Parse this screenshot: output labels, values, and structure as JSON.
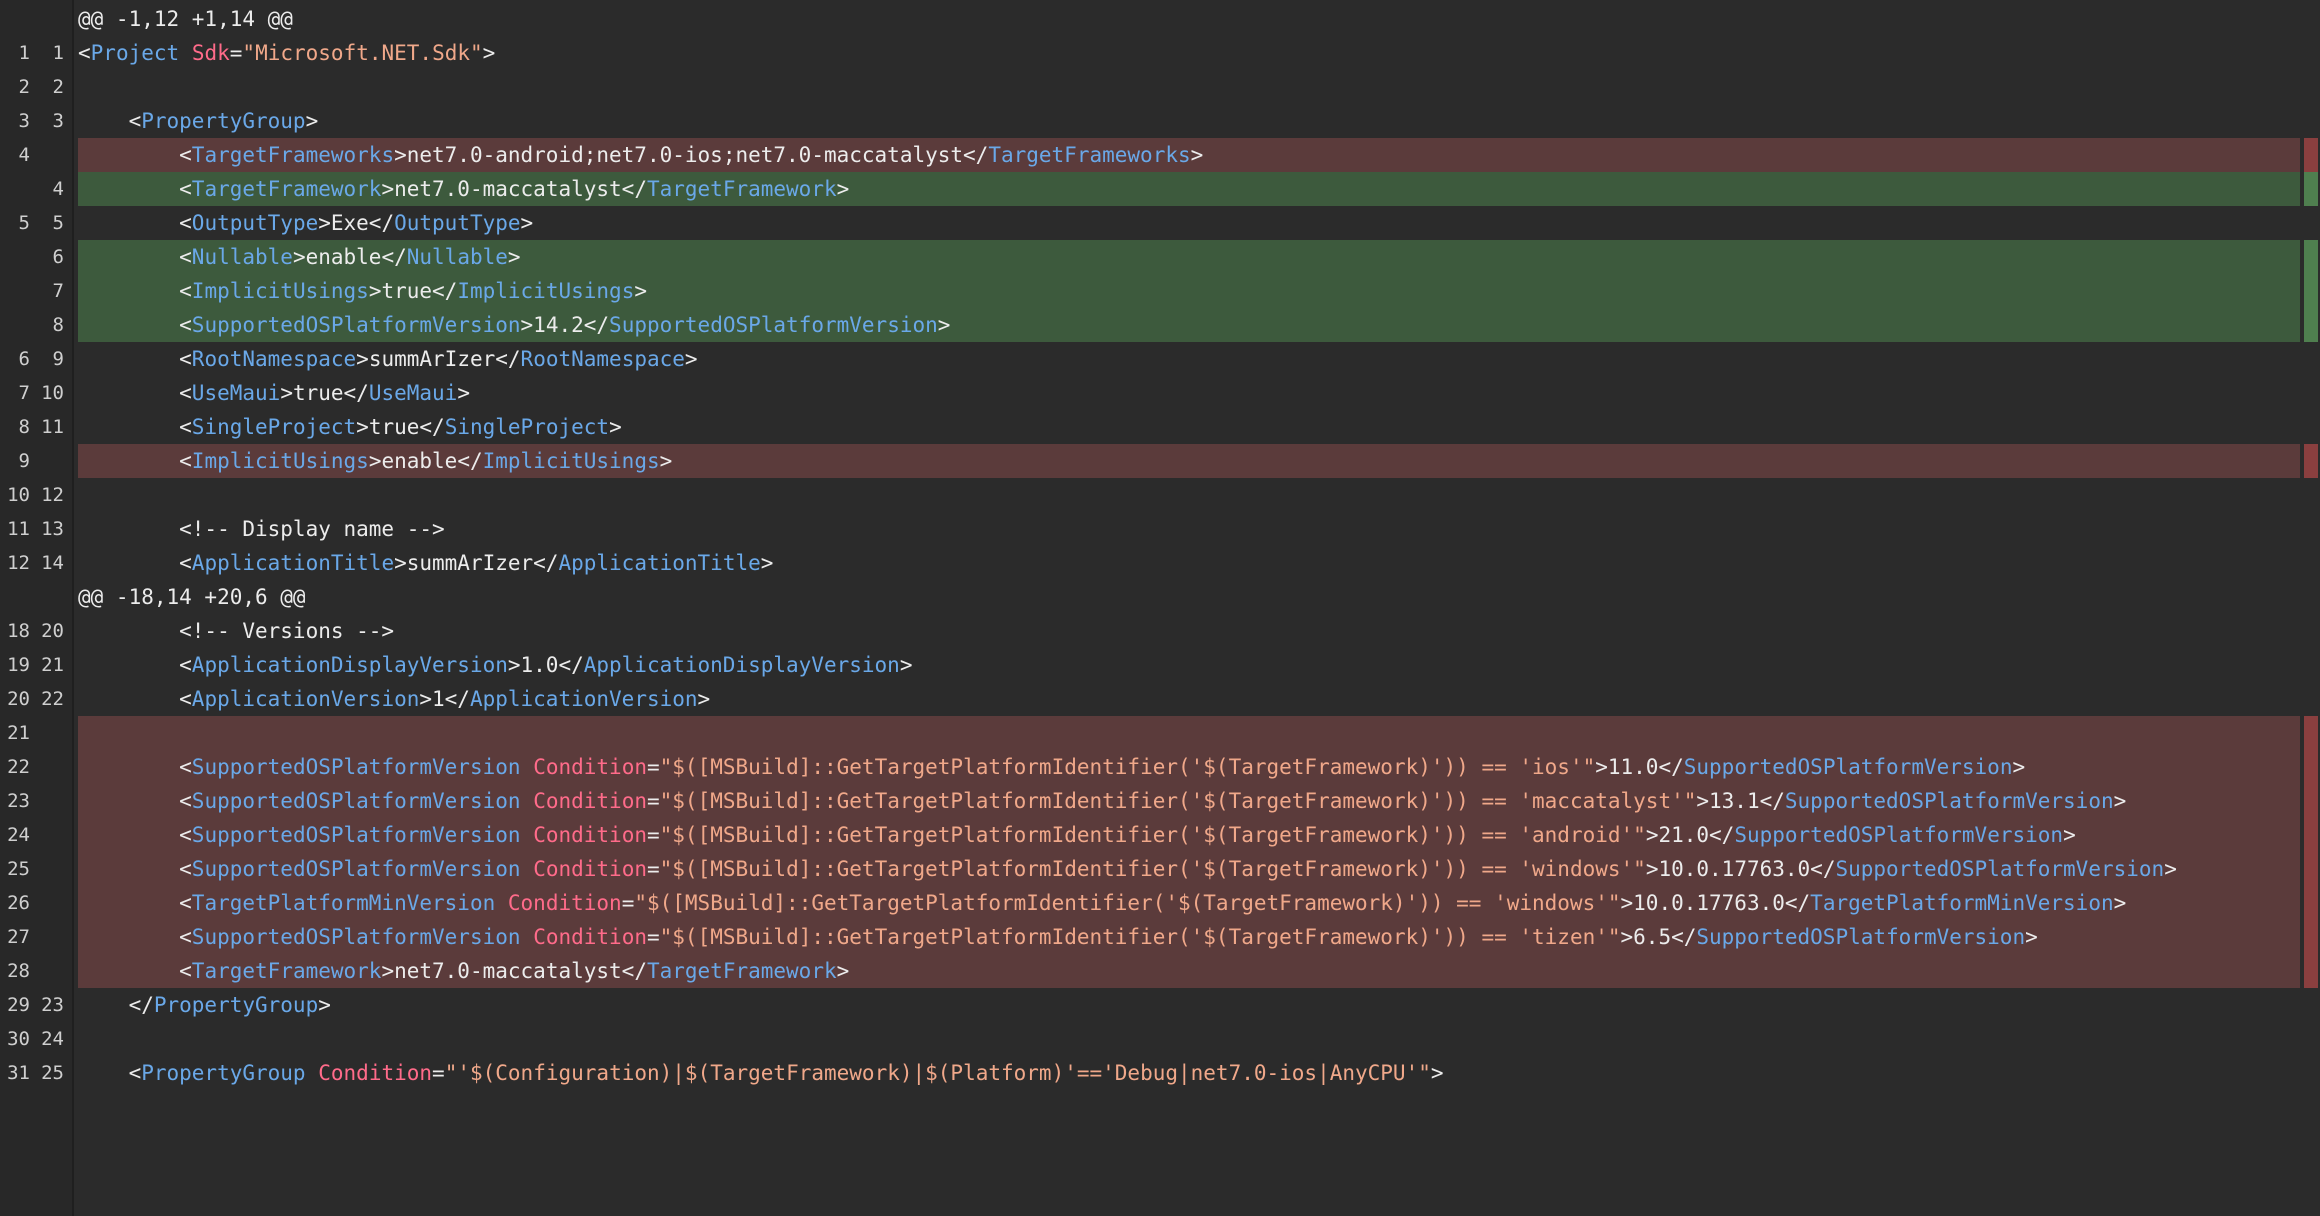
{
  "theme": {
    "background": "#2b2b2b",
    "deleted_bg": "#5b3b3b",
    "added_bg": "#3d5a3d",
    "tag_color": "#6aa8e8",
    "attribute_color": "#ff6b8a",
    "string_color": "#f0a88a"
  },
  "diff": [
    {
      "type": "hunk",
      "old": "",
      "new": "",
      "tokens": [
        {
          "k": "text",
          "t": "@@ -1,12 +1,14 @@"
        }
      ]
    },
    {
      "type": "ctx",
      "old": "1",
      "new": "1",
      "tokens": [
        {
          "k": "text",
          "t": "<"
        },
        {
          "k": "tag",
          "t": "Project"
        },
        {
          "k": "text",
          "t": " "
        },
        {
          "k": "attr",
          "t": "Sdk"
        },
        {
          "k": "text",
          "t": "="
        },
        {
          "k": "str",
          "t": "\"Microsoft.NET.Sdk\""
        },
        {
          "k": "text",
          "t": ">"
        }
      ]
    },
    {
      "type": "ctx",
      "old": "2",
      "new": "2",
      "tokens": []
    },
    {
      "type": "ctx",
      "old": "3",
      "new": "3",
      "tokens": [
        {
          "k": "text",
          "t": "    <"
        },
        {
          "k": "tag",
          "t": "PropertyGroup"
        },
        {
          "k": "text",
          "t": ">"
        }
      ]
    },
    {
      "type": "del",
      "old": "4",
      "new": "",
      "tokens": [
        {
          "k": "text",
          "t": "        <"
        },
        {
          "k": "tag",
          "t": "TargetFrameworks"
        },
        {
          "k": "text",
          "t": ">net7.0-android;net7.0-ios;net7.0-maccatalyst</"
        },
        {
          "k": "tag",
          "t": "TargetFrameworks"
        },
        {
          "k": "text",
          "t": ">"
        }
      ]
    },
    {
      "type": "add",
      "old": "",
      "new": "4",
      "tokens": [
        {
          "k": "text",
          "t": "        <"
        },
        {
          "k": "tag",
          "t": "TargetFramework"
        },
        {
          "k": "text",
          "t": ">net7.0-maccatalyst</"
        },
        {
          "k": "tag",
          "t": "TargetFramework"
        },
        {
          "k": "text",
          "t": ">"
        }
      ]
    },
    {
      "type": "ctx",
      "old": "5",
      "new": "5",
      "tokens": [
        {
          "k": "text",
          "t": "        <"
        },
        {
          "k": "tag",
          "t": "OutputType"
        },
        {
          "k": "text",
          "t": ">Exe</"
        },
        {
          "k": "tag",
          "t": "OutputType"
        },
        {
          "k": "text",
          "t": ">"
        }
      ]
    },
    {
      "type": "add",
      "old": "",
      "new": "6",
      "tokens": [
        {
          "k": "text",
          "t": "        <"
        },
        {
          "k": "tag",
          "t": "Nullable"
        },
        {
          "k": "text",
          "t": ">enable</"
        },
        {
          "k": "tag",
          "t": "Nullable"
        },
        {
          "k": "text",
          "t": ">"
        }
      ]
    },
    {
      "type": "add",
      "old": "",
      "new": "7",
      "tokens": [
        {
          "k": "text",
          "t": "        <"
        },
        {
          "k": "tag",
          "t": "ImplicitUsings"
        },
        {
          "k": "text",
          "t": ">true</"
        },
        {
          "k": "tag",
          "t": "ImplicitUsings"
        },
        {
          "k": "text",
          "t": ">"
        }
      ]
    },
    {
      "type": "add",
      "old": "",
      "new": "8",
      "tokens": [
        {
          "k": "text",
          "t": "        <"
        },
        {
          "k": "tag",
          "t": "SupportedOSPlatformVersion"
        },
        {
          "k": "text",
          "t": ">14.2</"
        },
        {
          "k": "tag",
          "t": "SupportedOSPlatformVersion"
        },
        {
          "k": "text",
          "t": ">"
        }
      ]
    },
    {
      "type": "ctx",
      "old": "6",
      "new": "9",
      "tokens": [
        {
          "k": "text",
          "t": "        <"
        },
        {
          "k": "tag",
          "t": "RootNamespace"
        },
        {
          "k": "text",
          "t": ">summArIzer</"
        },
        {
          "k": "tag",
          "t": "RootNamespace"
        },
        {
          "k": "text",
          "t": ">"
        }
      ]
    },
    {
      "type": "ctx",
      "old": "7",
      "new": "10",
      "tokens": [
        {
          "k": "text",
          "t": "        <"
        },
        {
          "k": "tag",
          "t": "UseMaui"
        },
        {
          "k": "text",
          "t": ">true</"
        },
        {
          "k": "tag",
          "t": "UseMaui"
        },
        {
          "k": "text",
          "t": ">"
        }
      ]
    },
    {
      "type": "ctx",
      "old": "8",
      "new": "11",
      "tokens": [
        {
          "k": "text",
          "t": "        <"
        },
        {
          "k": "tag",
          "t": "SingleProject"
        },
        {
          "k": "text",
          "t": ">true</"
        },
        {
          "k": "tag",
          "t": "SingleProject"
        },
        {
          "k": "text",
          "t": ">"
        }
      ]
    },
    {
      "type": "del",
      "old": "9",
      "new": "",
      "tokens": [
        {
          "k": "text",
          "t": "        <"
        },
        {
          "k": "tag",
          "t": "ImplicitUsings"
        },
        {
          "k": "text",
          "t": ">enable</"
        },
        {
          "k": "tag",
          "t": "ImplicitUsings"
        },
        {
          "k": "text",
          "t": ">"
        }
      ]
    },
    {
      "type": "ctx",
      "old": "10",
      "new": "12",
      "tokens": []
    },
    {
      "type": "ctx",
      "old": "11",
      "new": "13",
      "tokens": [
        {
          "k": "text",
          "t": "        <!-- Display name -->"
        }
      ]
    },
    {
      "type": "ctx",
      "old": "12",
      "new": "14",
      "tokens": [
        {
          "k": "text",
          "t": "        <"
        },
        {
          "k": "tag",
          "t": "ApplicationTitle"
        },
        {
          "k": "text",
          "t": ">summArIzer</"
        },
        {
          "k": "tag",
          "t": "ApplicationTitle"
        },
        {
          "k": "text",
          "t": ">"
        }
      ]
    },
    {
      "type": "hunk",
      "old": "",
      "new": "",
      "tokens": [
        {
          "k": "text",
          "t": "@@ -18,14 +20,6 @@"
        }
      ]
    },
    {
      "type": "ctx",
      "old": "18",
      "new": "20",
      "tokens": [
        {
          "k": "text",
          "t": "        <!-- Versions -->"
        }
      ]
    },
    {
      "type": "ctx",
      "old": "19",
      "new": "21",
      "tokens": [
        {
          "k": "text",
          "t": "        <"
        },
        {
          "k": "tag",
          "t": "ApplicationDisplayVersion"
        },
        {
          "k": "text",
          "t": ">1.0</"
        },
        {
          "k": "tag",
          "t": "ApplicationDisplayVersion"
        },
        {
          "k": "text",
          "t": ">"
        }
      ]
    },
    {
      "type": "ctx",
      "old": "20",
      "new": "22",
      "tokens": [
        {
          "k": "text",
          "t": "        <"
        },
        {
          "k": "tag",
          "t": "ApplicationVersion"
        },
        {
          "k": "text",
          "t": ">1</"
        },
        {
          "k": "tag",
          "t": "ApplicationVersion"
        },
        {
          "k": "text",
          "t": ">"
        }
      ]
    },
    {
      "type": "del",
      "old": "21",
      "new": "",
      "tokens": []
    },
    {
      "type": "del",
      "old": "22",
      "new": "",
      "tokens": [
        {
          "k": "text",
          "t": "        <"
        },
        {
          "k": "tag",
          "t": "SupportedOSPlatformVersion"
        },
        {
          "k": "text",
          "t": " "
        },
        {
          "k": "attr",
          "t": "Condition"
        },
        {
          "k": "text",
          "t": "="
        },
        {
          "k": "str",
          "t": "\"$([MSBuild]::GetTargetPlatformIdentifier('$(TargetFramework)')) == 'ios'\""
        },
        {
          "k": "text",
          "t": ">11.0</"
        },
        {
          "k": "tag",
          "t": "SupportedOSPlatformVersion"
        },
        {
          "k": "text",
          "t": ">"
        }
      ]
    },
    {
      "type": "del",
      "old": "23",
      "new": "",
      "tokens": [
        {
          "k": "text",
          "t": "        <"
        },
        {
          "k": "tag",
          "t": "SupportedOSPlatformVersion"
        },
        {
          "k": "text",
          "t": " "
        },
        {
          "k": "attr",
          "t": "Condition"
        },
        {
          "k": "text",
          "t": "="
        },
        {
          "k": "str",
          "t": "\"$([MSBuild]::GetTargetPlatformIdentifier('$(TargetFramework)')) == 'maccatalyst'\""
        },
        {
          "k": "text",
          "t": ">13.1</"
        },
        {
          "k": "tag",
          "t": "SupportedOSPlatformVersion"
        },
        {
          "k": "text",
          "t": ">"
        }
      ]
    },
    {
      "type": "del",
      "old": "24",
      "new": "",
      "tokens": [
        {
          "k": "text",
          "t": "        <"
        },
        {
          "k": "tag",
          "t": "SupportedOSPlatformVersion"
        },
        {
          "k": "text",
          "t": " "
        },
        {
          "k": "attr",
          "t": "Condition"
        },
        {
          "k": "text",
          "t": "="
        },
        {
          "k": "str",
          "t": "\"$([MSBuild]::GetTargetPlatformIdentifier('$(TargetFramework)')) == 'android'\""
        },
        {
          "k": "text",
          "t": ">21.0</"
        },
        {
          "k": "tag",
          "t": "SupportedOSPlatformVersion"
        },
        {
          "k": "text",
          "t": ">"
        }
      ]
    },
    {
      "type": "del",
      "old": "25",
      "new": "",
      "tokens": [
        {
          "k": "text",
          "t": "        <"
        },
        {
          "k": "tag",
          "t": "SupportedOSPlatformVersion"
        },
        {
          "k": "text",
          "t": " "
        },
        {
          "k": "attr",
          "t": "Condition"
        },
        {
          "k": "text",
          "t": "="
        },
        {
          "k": "str",
          "t": "\"$([MSBuild]::GetTargetPlatformIdentifier('$(TargetFramework)')) == 'windows'\""
        },
        {
          "k": "text",
          "t": ">10.0.17763.0</"
        },
        {
          "k": "tag",
          "t": "SupportedOSPlatformVersion"
        },
        {
          "k": "text",
          "t": ">"
        }
      ]
    },
    {
      "type": "del",
      "old": "26",
      "new": "",
      "tokens": [
        {
          "k": "text",
          "t": "        <"
        },
        {
          "k": "tag",
          "t": "TargetPlatformMinVersion"
        },
        {
          "k": "text",
          "t": " "
        },
        {
          "k": "attr",
          "t": "Condition"
        },
        {
          "k": "text",
          "t": "="
        },
        {
          "k": "str",
          "t": "\"$([MSBuild]::GetTargetPlatformIdentifier('$(TargetFramework)')) == 'windows'\""
        },
        {
          "k": "text",
          "t": ">10.0.17763.0</"
        },
        {
          "k": "tag",
          "t": "TargetPlatformMinVersion"
        },
        {
          "k": "text",
          "t": ">"
        }
      ]
    },
    {
      "type": "del",
      "old": "27",
      "new": "",
      "tokens": [
        {
          "k": "text",
          "t": "        <"
        },
        {
          "k": "tag",
          "t": "SupportedOSPlatformVersion"
        },
        {
          "k": "text",
          "t": " "
        },
        {
          "k": "attr",
          "t": "Condition"
        },
        {
          "k": "text",
          "t": "="
        },
        {
          "k": "str",
          "t": "\"$([MSBuild]::GetTargetPlatformIdentifier('$(TargetFramework)')) == 'tizen'\""
        },
        {
          "k": "text",
          "t": ">6.5</"
        },
        {
          "k": "tag",
          "t": "SupportedOSPlatformVersion"
        },
        {
          "k": "text",
          "t": ">"
        }
      ]
    },
    {
      "type": "del",
      "old": "28",
      "new": "",
      "tokens": [
        {
          "k": "text",
          "t": "        <"
        },
        {
          "k": "tag",
          "t": "TargetFramework"
        },
        {
          "k": "text",
          "t": ">net7.0-maccatalyst</"
        },
        {
          "k": "tag",
          "t": "TargetFramework"
        },
        {
          "k": "text",
          "t": ">"
        }
      ]
    },
    {
      "type": "ctx",
      "old": "29",
      "new": "23",
      "tokens": [
        {
          "k": "text",
          "t": "    </"
        },
        {
          "k": "tag",
          "t": "PropertyGroup"
        },
        {
          "k": "text",
          "t": ">"
        }
      ]
    },
    {
      "type": "ctx",
      "old": "30",
      "new": "24",
      "tokens": []
    },
    {
      "type": "ctx",
      "old": "31",
      "new": "25",
      "tokens": [
        {
          "k": "text",
          "t": "    <"
        },
        {
          "k": "tag",
          "t": "PropertyGroup"
        },
        {
          "k": "text",
          "t": " "
        },
        {
          "k": "attr",
          "t": "Condition"
        },
        {
          "k": "text",
          "t": "="
        },
        {
          "k": "str",
          "t": "\"'$(Configuration)|$(TargetFramework)|$(Platform)'=='Debug|net7.0-ios|AnyCPU'\""
        },
        {
          "k": "text",
          "t": ">"
        }
      ]
    }
  ]
}
